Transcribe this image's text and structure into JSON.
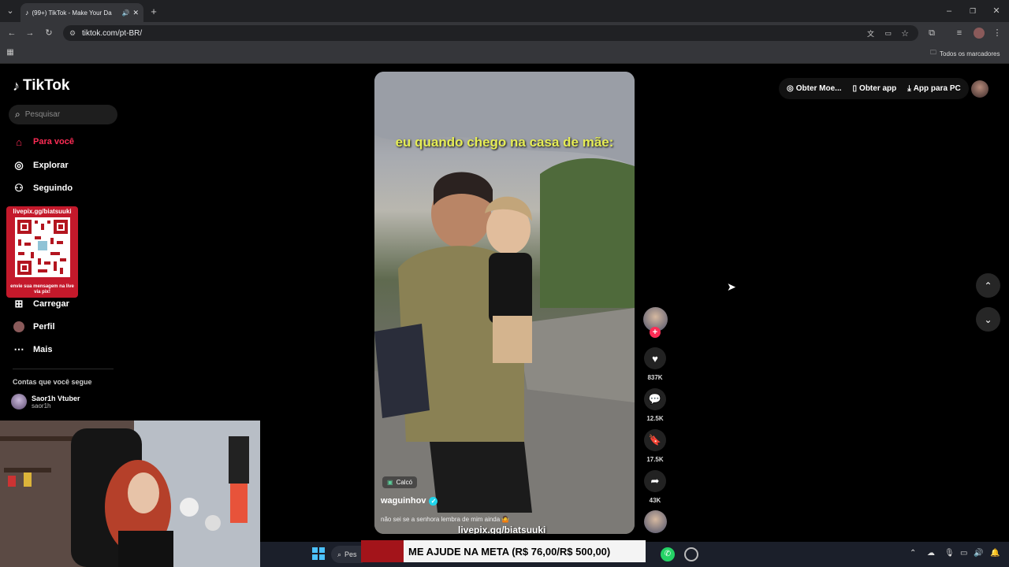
{
  "browser": {
    "tab_title": "(99+) TikTok - Make Your Da",
    "url": "tiktok.com/pt-BR/",
    "bookmarks_label": "Todos os marcadores"
  },
  "sidebar": {
    "logo": "TikTok",
    "search_placeholder": "Pesquisar",
    "items": [
      {
        "label": "Para você",
        "icon": "home-icon"
      },
      {
        "label": "Explorar",
        "icon": "compass-icon"
      },
      {
        "label": "Seguindo",
        "icon": "users-icon"
      },
      {
        "label": "Carregar",
        "icon": "plus-square-icon"
      },
      {
        "label": "Perfil",
        "icon": "profile-icon"
      },
      {
        "label": "Mais",
        "icon": "more-icon"
      }
    ],
    "following_heading": "Contas que você segue",
    "accounts": [
      {
        "name": "Saor1h Vtuber",
        "handle": "saor1h"
      }
    ]
  },
  "overlay": {
    "qr_label": "livepix.gg/biatsuuki",
    "qr_caption": "envie sua mensagem na live via pix!",
    "video_link": "livepix.gg/biatsuuki",
    "goal_text": "ME AJUDE NA META (R$ 76,00/R$ 500,00)"
  },
  "video": {
    "caption": "eu quando chego na casa de mãe:",
    "tag": "Calcó",
    "author": "waguinhov",
    "description": "não sei se a senhora lembra de mim ainda 🤷"
  },
  "actions": {
    "likes": "837K",
    "comments": "12.5K",
    "saves": "17.5K",
    "shares": "43K"
  },
  "topbar": {
    "coins": "Obter Moe...",
    "get_app": "Obter app",
    "pc_app": "App para PC"
  },
  "taskbar": {
    "search_stub": "Pes"
  },
  "colors": {
    "accent": "#fe2c55",
    "caption": "#e6ed55",
    "goal_red": "#a3141a"
  }
}
